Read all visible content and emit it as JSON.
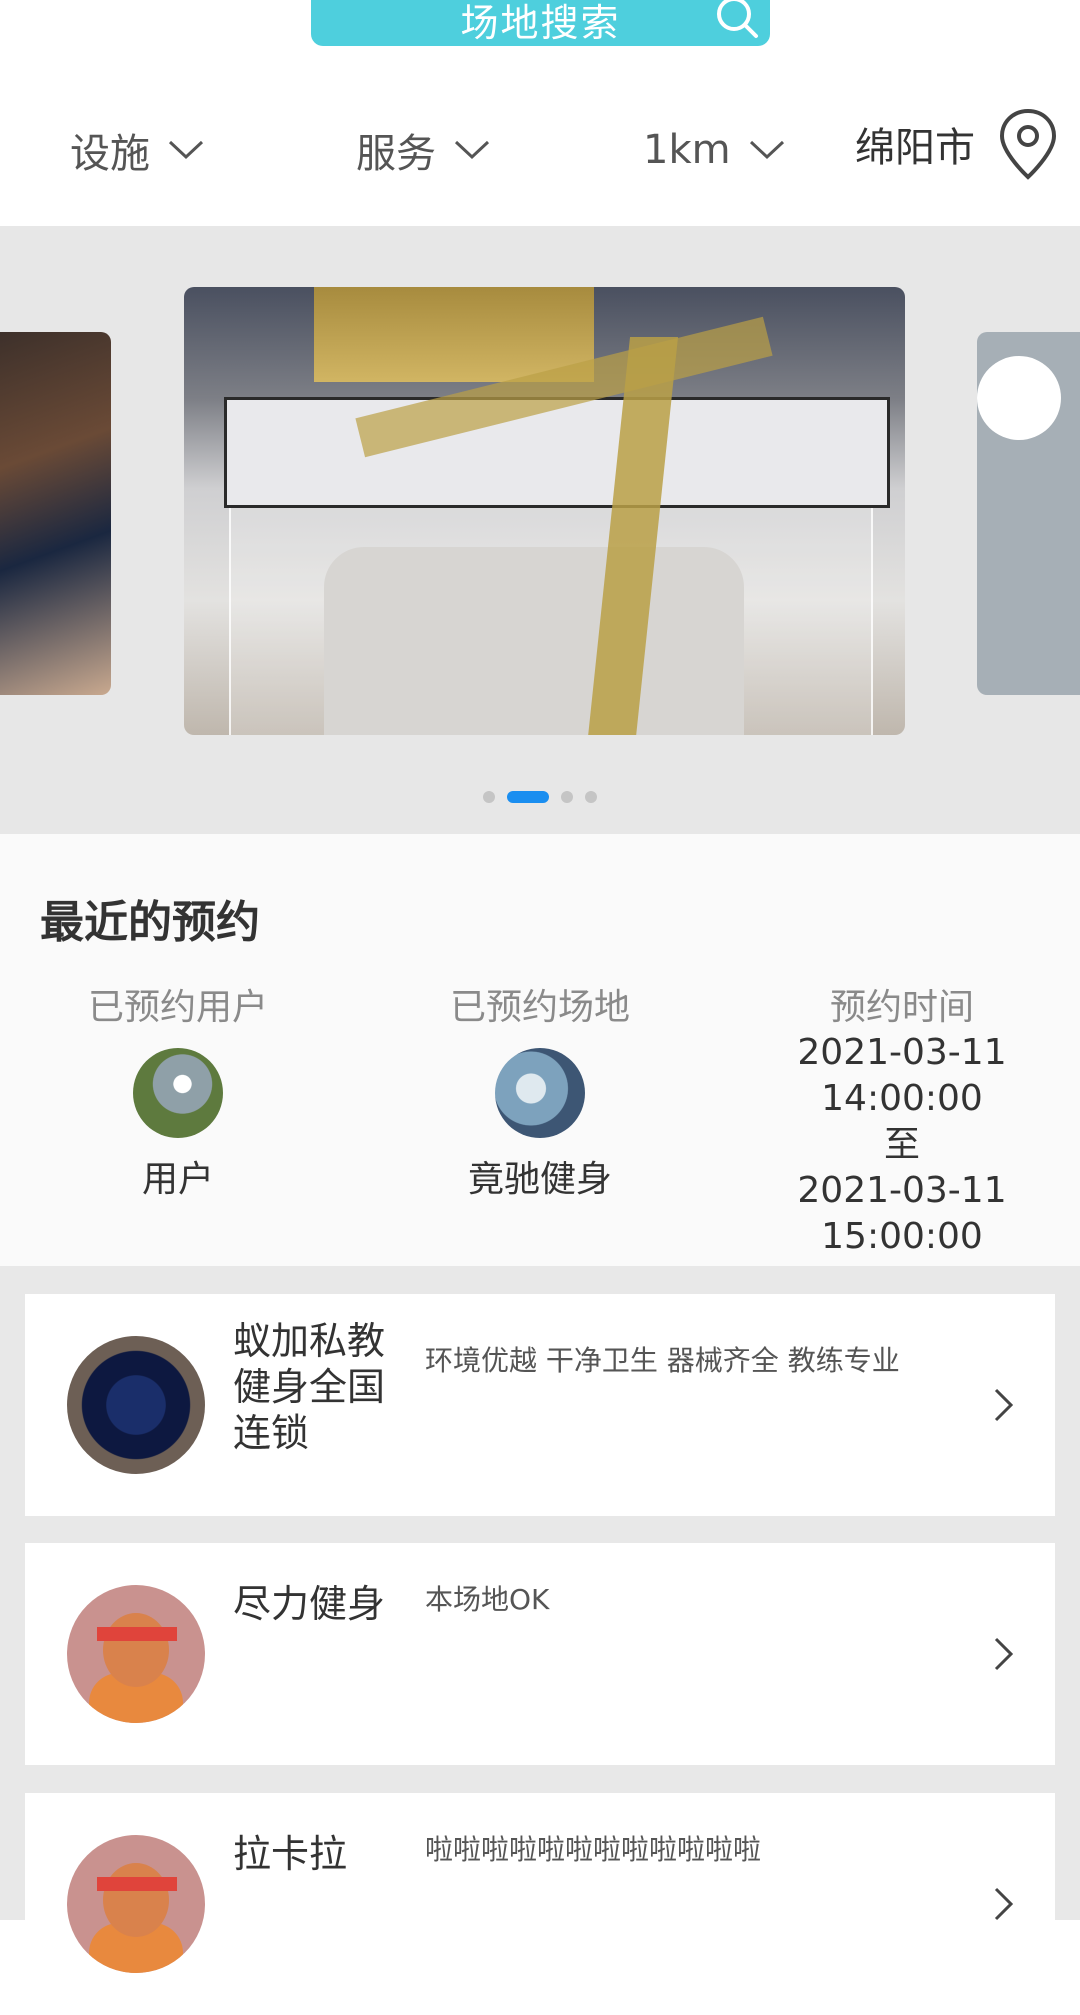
{
  "search": {
    "label": "场地搜索"
  },
  "filters": {
    "facility": "设施",
    "service": "服务",
    "distance": "1km",
    "city": "绵阳市"
  },
  "banner": {
    "slide_count": 4,
    "active_index": 1
  },
  "recent": {
    "title": "最近的预约",
    "user_header": "已预约用户",
    "user_name": "用户",
    "venue_header": "已预约场地",
    "venue_name": "竟驰健身",
    "time_header": "预约时间",
    "start_date": "2021-03-11",
    "start_time": "14:00:00",
    "separator": "至",
    "end_date": "2021-03-11",
    "end_time": "15:00:00"
  },
  "venues": [
    {
      "name": "蚁加私教健身全国连锁",
      "desc": "环境优越 干净卫生 器械齐全 教练专业",
      "icon": "gym-photo"
    },
    {
      "name": "尽力健身",
      "desc": "本场地OK",
      "icon": "placeholder-avatar"
    },
    {
      "name": "拉卡拉",
      "desc": "啦啦啦啦啦啦啦啦啦啦啦啦",
      "icon": "placeholder-avatar"
    }
  ],
  "colors": {
    "search_bg": "#4ecfdd",
    "active_dot": "#1a8ef0",
    "list_bg": "#e8e8e8"
  }
}
